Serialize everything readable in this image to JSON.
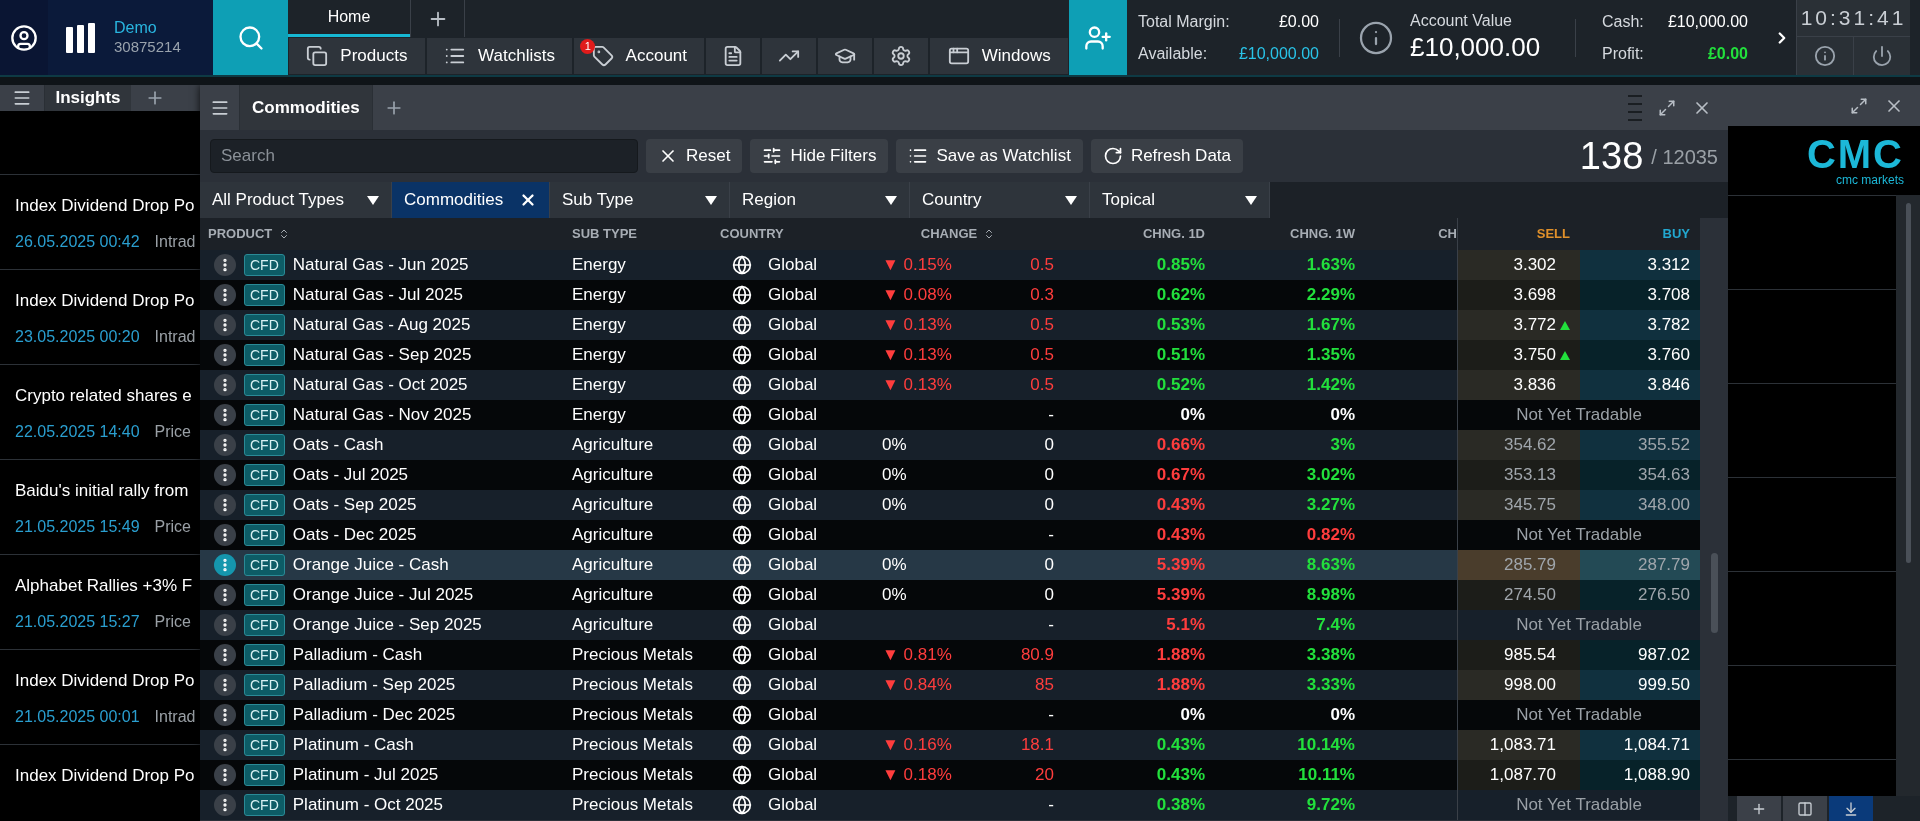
{
  "top_bar": {
    "account_mode": "Demo",
    "account_number": "30875214",
    "tabs": [
      {
        "label": "Home",
        "selected": true
      }
    ],
    "nav": [
      {
        "kind": "products",
        "label": "Products"
      },
      {
        "kind": "watchlists",
        "label": "Watchlists"
      },
      {
        "kind": "account",
        "label": "Account",
        "badge": "1"
      },
      {
        "kind": "report"
      },
      {
        "kind": "chart"
      },
      {
        "kind": "learn"
      },
      {
        "kind": "settings"
      },
      {
        "kind": "windows",
        "label": "Windows"
      }
    ],
    "summary": {
      "total_margin_label": "Total Margin:",
      "total_margin": "£0.00",
      "available_label": "Available:",
      "available": "£10,000.00",
      "account_value_label": "Account Value",
      "account_value": "£10,000.00",
      "cash_label": "Cash:",
      "cash": "£10,000.00",
      "profit_label": "Profit:",
      "profit": "£0.00"
    },
    "clock": "10:31:41"
  },
  "insights": {
    "tab": "Insights",
    "logo": {
      "mark": "CMC",
      "name": "cmc markets"
    },
    "items": [
      {
        "title": "Index Dividend Drop Po",
        "date": "26.05.2025 00:42",
        "category": "Intrad"
      },
      {
        "title": "Index Dividend Drop Po",
        "date": "23.05.2025 00:20",
        "category": "Intrad"
      },
      {
        "title": "Crypto related shares e",
        "date": "22.05.2025 14:40",
        "category": "Price"
      },
      {
        "title": "Baidu's initial rally from",
        "date": "21.05.2025 15:49",
        "category": "Price"
      },
      {
        "title": "Alphabet Rallies +3% F",
        "date": "21.05.2025 15:27",
        "category": "Price"
      },
      {
        "title": "Index Dividend Drop Po",
        "date": "21.05.2025 00:01",
        "category": "Intrad"
      },
      {
        "title": "Index Dividend Drop Po"
      }
    ],
    "dock_buttons": [
      {
        "kind": "add",
        "selected": false
      },
      {
        "kind": "split",
        "selected": false
      },
      {
        "kind": "dock",
        "selected": true
      }
    ]
  },
  "commodities": {
    "tab": "Commodities",
    "search": {
      "placeholder": "Search"
    },
    "buttons": [
      {
        "kind": "reset",
        "label": "Reset"
      },
      {
        "kind": "filters",
        "label": "Hide Filters"
      },
      {
        "kind": "watchlist",
        "label": "Save as Watchlist"
      },
      {
        "kind": "refresh",
        "label": "Refresh Data"
      }
    ],
    "count": "138",
    "total": "/ 12035",
    "filters": [
      {
        "label": "All Product Types",
        "active": false
      },
      {
        "label": "Commodities",
        "active": true
      },
      {
        "label": "Sub Type",
        "active": false
      },
      {
        "label": "Region",
        "active": false
      },
      {
        "label": "Country",
        "active": false
      },
      {
        "label": "Topical",
        "active": false
      }
    ],
    "columns": [
      {
        "kind": "product",
        "label": "PRODUCT",
        "sortable": true
      },
      {
        "kind": "sub_type",
        "label": "SUB TYPE",
        "sortable": false
      },
      {
        "kind": "country",
        "label": "COUNTRY",
        "sortable": false
      },
      {
        "kind": "change",
        "label": "CHANGE",
        "sortable": true
      },
      {
        "kind": "chng_1d",
        "label": "CHNG. 1D",
        "sortable": false
      },
      {
        "kind": "chng_1w",
        "label": "CHNG. 1W",
        "sortable": false
      },
      {
        "kind": "cut",
        "label": "CH",
        "sortable": false
      },
      {
        "kind": "sell",
        "label": "SELL",
        "sortable": false
      },
      {
        "kind": "buy",
        "label": "BUY",
        "sortable": false
      }
    ],
    "rows": [
      {
        "selected": false,
        "type": "CFD",
        "product": "Natural Gas - Jun 2025",
        "sub_type": "Energy",
        "country": "Global",
        "change": {
          "kind": "down",
          "pct": "▼ 0.15%",
          "value": "0.5"
        },
        "chng_1d": {
          "kind": "up",
          "value": "0.85%"
        },
        "chng_1w": {
          "kind": "up",
          "value": "1.63%"
        },
        "kind": "priced",
        "sell": "3.302",
        "buy": "3.312",
        "sell_rising": false,
        "prices_muted": false
      },
      {
        "selected": false,
        "type": "CFD",
        "product": "Natural Gas - Jul 2025",
        "sub_type": "Energy",
        "country": "Global",
        "change": {
          "kind": "down",
          "pct": "▼ 0.08%",
          "value": "0.3"
        },
        "chng_1d": {
          "kind": "up",
          "value": "0.62%"
        },
        "chng_1w": {
          "kind": "up",
          "value": "2.29%"
        },
        "kind": "priced",
        "sell": "3.698",
        "buy": "3.708",
        "sell_rising": false,
        "prices_muted": false
      },
      {
        "selected": false,
        "type": "CFD",
        "product": "Natural Gas - Aug 2025",
        "sub_type": "Energy",
        "country": "Global",
        "change": {
          "kind": "down",
          "pct": "▼ 0.13%",
          "value": "0.5"
        },
        "chng_1d": {
          "kind": "up",
          "value": "0.53%"
        },
        "chng_1w": {
          "kind": "up",
          "value": "1.67%"
        },
        "kind": "priced",
        "sell": "3.772",
        "buy": "3.782",
        "sell_rising": true,
        "prices_muted": false
      },
      {
        "selected": false,
        "type": "CFD",
        "product": "Natural Gas - Sep 2025",
        "sub_type": "Energy",
        "country": "Global",
        "change": {
          "kind": "down",
          "pct": "▼ 0.13%",
          "value": "0.5"
        },
        "chng_1d": {
          "kind": "up",
          "value": "0.51%"
        },
        "chng_1w": {
          "kind": "up",
          "value": "1.35%"
        },
        "kind": "priced",
        "sell": "3.750",
        "buy": "3.760",
        "sell_rising": true,
        "prices_muted": false
      },
      {
        "selected": false,
        "type": "CFD",
        "product": "Natural Gas - Oct 2025",
        "sub_type": "Energy",
        "country": "Global",
        "change": {
          "kind": "down",
          "pct": "▼ 0.13%",
          "value": "0.5"
        },
        "chng_1d": {
          "kind": "up",
          "value": "0.52%"
        },
        "chng_1w": {
          "kind": "up",
          "value": "1.42%"
        },
        "kind": "priced",
        "sell": "3.836",
        "buy": "3.846",
        "sell_rising": false,
        "prices_muted": false
      },
      {
        "selected": false,
        "type": "CFD",
        "product": "Natural Gas - Nov 2025",
        "sub_type": "Energy",
        "country": "Global",
        "change": {
          "kind": "flat",
          "value": "-"
        },
        "chng_1d": {
          "kind": "flat",
          "value": "0%"
        },
        "chng_1w": {
          "kind": "flat",
          "value": "0%"
        },
        "kind": "not_tradable",
        "status": "Not Yet Tradable"
      },
      {
        "selected": false,
        "type": "CFD",
        "product": "Oats - Cash",
        "sub_type": "Agriculture",
        "country": "Global",
        "change": {
          "kind": "flat",
          "pct": "0%",
          "value": "0"
        },
        "chng_1d": {
          "kind": "down",
          "value": "0.66%"
        },
        "chng_1w": {
          "kind": "up",
          "value": "3%"
        },
        "kind": "priced",
        "sell": "354.62",
        "buy": "355.52",
        "sell_rising": false,
        "prices_muted": true
      },
      {
        "selected": false,
        "type": "CFD",
        "product": "Oats - Jul 2025",
        "sub_type": "Agriculture",
        "country": "Global",
        "change": {
          "kind": "flat",
          "pct": "0%",
          "value": "0"
        },
        "chng_1d": {
          "kind": "down",
          "value": "0.67%"
        },
        "chng_1w": {
          "kind": "up",
          "value": "3.02%"
        },
        "kind": "priced",
        "sell": "353.13",
        "buy": "354.63",
        "sell_rising": false,
        "prices_muted": true
      },
      {
        "selected": false,
        "type": "CFD",
        "product": "Oats - Sep 2025",
        "sub_type": "Agriculture",
        "country": "Global",
        "change": {
          "kind": "flat",
          "pct": "0%",
          "value": "0"
        },
        "chng_1d": {
          "kind": "down",
          "value": "0.43%"
        },
        "chng_1w": {
          "kind": "up",
          "value": "3.27%"
        },
        "kind": "priced",
        "sell": "345.75",
        "buy": "348.00",
        "sell_rising": false,
        "prices_muted": true
      },
      {
        "selected": false,
        "type": "CFD",
        "product": "Oats - Dec 2025",
        "sub_type": "Agriculture",
        "country": "Global",
        "change": {
          "kind": "flat",
          "value": "-"
        },
        "chng_1d": {
          "kind": "down",
          "value": "0.43%"
        },
        "chng_1w": {
          "kind": "down",
          "value": "0.82%"
        },
        "kind": "not_tradable",
        "status": "Not Yet Tradable"
      },
      {
        "selected": true,
        "type": "CFD",
        "product": "Orange Juice - Cash",
        "sub_type": "Agriculture",
        "country": "Global",
        "change": {
          "kind": "flat",
          "pct": "0%",
          "value": "0"
        },
        "chng_1d": {
          "kind": "down",
          "value": "5.39%"
        },
        "chng_1w": {
          "kind": "up",
          "value": "8.63%"
        },
        "kind": "priced",
        "sell": "285.79",
        "buy": "287.79",
        "sell_rising": false,
        "prices_muted": true
      },
      {
        "selected": false,
        "type": "CFD",
        "product": "Orange Juice - Jul 2025",
        "sub_type": "Agriculture",
        "country": "Global",
        "change": {
          "kind": "flat",
          "pct": "0%",
          "value": "0"
        },
        "chng_1d": {
          "kind": "down",
          "value": "5.39%"
        },
        "chng_1w": {
          "kind": "up",
          "value": "8.98%"
        },
        "kind": "priced",
        "sell": "274.50",
        "buy": "276.50",
        "sell_rising": false,
        "prices_muted": true
      },
      {
        "selected": false,
        "type": "CFD",
        "product": "Orange Juice - Sep 2025",
        "sub_type": "Agriculture",
        "country": "Global",
        "change": {
          "kind": "flat",
          "value": "-"
        },
        "chng_1d": {
          "kind": "down",
          "value": "5.1%"
        },
        "chng_1w": {
          "kind": "up",
          "value": "7.4%"
        },
        "kind": "not_tradable",
        "status": "Not Yet Tradable"
      },
      {
        "selected": false,
        "type": "CFD",
        "product": "Palladium - Cash",
        "sub_type": "Precious Metals",
        "country": "Global",
        "change": {
          "kind": "down",
          "pct": "▼ 0.81%",
          "value": "80.9"
        },
        "chng_1d": {
          "kind": "down",
          "value": "1.88%"
        },
        "chng_1w": {
          "kind": "up",
          "value": "3.38%"
        },
        "kind": "priced",
        "sell": "985.54",
        "buy": "987.02",
        "sell_rising": false,
        "prices_muted": false
      },
      {
        "selected": false,
        "type": "CFD",
        "product": "Palladium - Sep 2025",
        "sub_type": "Precious Metals",
        "country": "Global",
        "change": {
          "kind": "down",
          "pct": "▼ 0.84%",
          "value": "85"
        },
        "chng_1d": {
          "kind": "down",
          "value": "1.88%"
        },
        "chng_1w": {
          "kind": "up",
          "value": "3.33%"
        },
        "kind": "priced",
        "sell": "998.00",
        "buy": "999.50",
        "sell_rising": false,
        "prices_muted": false
      },
      {
        "selected": false,
        "type": "CFD",
        "product": "Palladium - Dec 2025",
        "sub_type": "Precious Metals",
        "country": "Global",
        "change": {
          "kind": "flat",
          "value": "-"
        },
        "chng_1d": {
          "kind": "flat",
          "value": "0%"
        },
        "chng_1w": {
          "kind": "flat",
          "value": "0%"
        },
        "kind": "not_tradable",
        "status": "Not Yet Tradable"
      },
      {
        "selected": false,
        "type": "CFD",
        "product": "Platinum - Cash",
        "sub_type": "Precious Metals",
        "country": "Global",
        "change": {
          "kind": "down",
          "pct": "▼ 0.16%",
          "value": "18.1"
        },
        "chng_1d": {
          "kind": "up",
          "value": "0.43%"
        },
        "chng_1w": {
          "kind": "up",
          "value": "10.14%"
        },
        "kind": "priced",
        "sell": "1,083.71",
        "buy": "1,084.71",
        "sell_rising": false,
        "prices_muted": false
      },
      {
        "selected": false,
        "type": "CFD",
        "product": "Platinum - Jul 2025",
        "sub_type": "Precious Metals",
        "country": "Global",
        "change": {
          "kind": "down",
          "pct": "▼ 0.18%",
          "value": "20"
        },
        "chng_1d": {
          "kind": "up",
          "value": "0.43%"
        },
        "chng_1w": {
          "kind": "up",
          "value": "10.11%"
        },
        "kind": "priced",
        "sell": "1,087.70",
        "buy": "1,088.90",
        "sell_rising": false,
        "prices_muted": false
      },
      {
        "selected": false,
        "type": "CFD",
        "product": "Platinum - Oct 2025",
        "sub_type": "Precious Metals",
        "country": "Global",
        "change": {
          "kind": "flat",
          "value": "-"
        },
        "chng_1d": {
          "kind": "up",
          "value": "0.38%"
        },
        "chng_1w": {
          "kind": "up",
          "value": "9.72%"
        },
        "kind": "not_tradable",
        "status": "Not Yet Tradable"
      }
    ]
  }
}
